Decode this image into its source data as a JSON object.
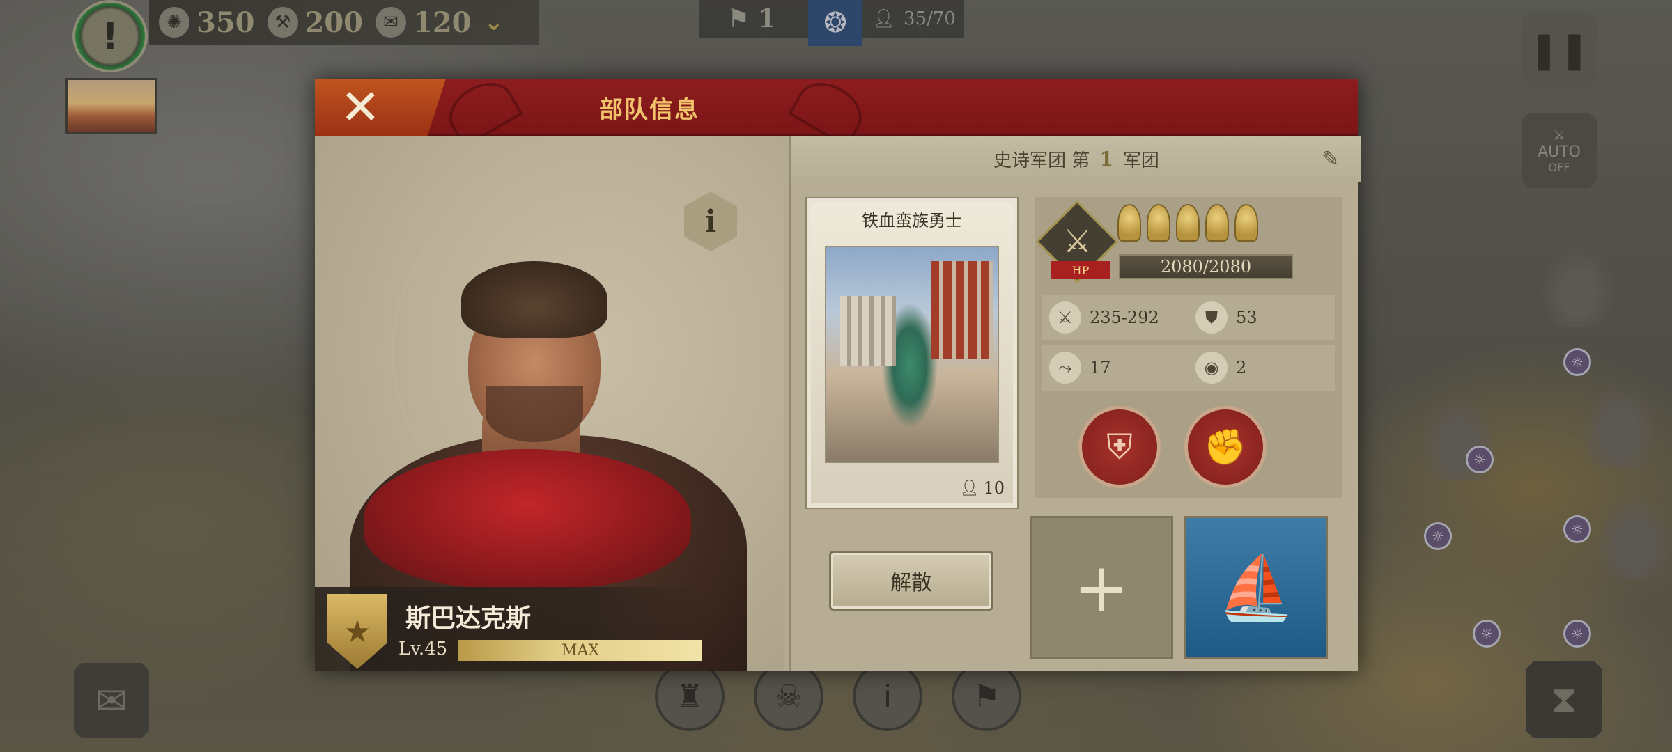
{
  "top_bar": {
    "alert_icon": "exclamation-icon",
    "resources": [
      {
        "icon": "laurel-coin-icon",
        "value": "350"
      },
      {
        "icon": "hammer-icon",
        "value": "200"
      },
      {
        "icon": "scroll-icon",
        "value": "120"
      }
    ],
    "expand_icon": "chevron-down-icon",
    "turn": {
      "icon": "flag-icon",
      "value": "1"
    },
    "population": {
      "icon": "person-icon",
      "value": "35/70"
    }
  },
  "side_buttons": {
    "auto_label": "AUTO",
    "auto_state": "OFF"
  },
  "dialog": {
    "title": "部队信息",
    "close_icon": "close-icon",
    "hero": {
      "name": "斯巴达克斯",
      "level": "Lv.45",
      "level_bar_text": "MAX",
      "level_progress": 1.0
    },
    "legion": {
      "prefix": "史诗军团 第",
      "number": "1",
      "suffix": "军团"
    },
    "unit_card": {
      "name": "铁血蛮族勇士",
      "count": "10"
    },
    "stats": {
      "hp_label": "HP",
      "hp": "2080/2080",
      "stars": 5,
      "attack": "235-292",
      "armor": "53",
      "movement": "17",
      "vision": "2"
    },
    "disband_label": "解散"
  },
  "colors": {
    "header_red": "#8d1d1e",
    "title_gold": "#f1c46b",
    "parchment": "#b3aa91"
  }
}
